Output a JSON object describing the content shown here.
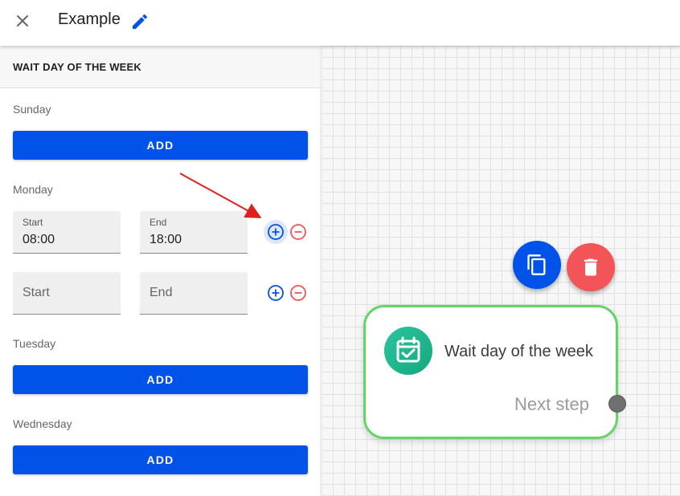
{
  "header": {
    "title": "Example",
    "close_icon": "close-icon",
    "edit_icon": "pencil-icon"
  },
  "panel": {
    "title": "WAIT DAY OF THE WEEK",
    "add_label": "ADD",
    "days": [
      {
        "label": "Sunday"
      },
      {
        "label": "Monday",
        "ranges": [
          {
            "start_label": "Start",
            "start_value": "08:00",
            "end_label": "End",
            "end_value": "18:00"
          },
          {
            "start_placeholder": "Start",
            "end_placeholder": "End"
          }
        ]
      },
      {
        "label": "Tuesday"
      },
      {
        "label": "Wednesday"
      }
    ]
  },
  "canvas": {
    "node": {
      "title": "Wait day of the week",
      "next_label": "Next step",
      "icon": "calendar-check-icon",
      "border_color": "#62d567"
    },
    "actions": {
      "copy_icon": "copy-icon",
      "delete_icon": "trash-icon"
    }
  },
  "colors": {
    "primary": "#0052e8",
    "danger": "#f25457",
    "node_border": "#62d567",
    "node_icon": "#1fb58d"
  }
}
